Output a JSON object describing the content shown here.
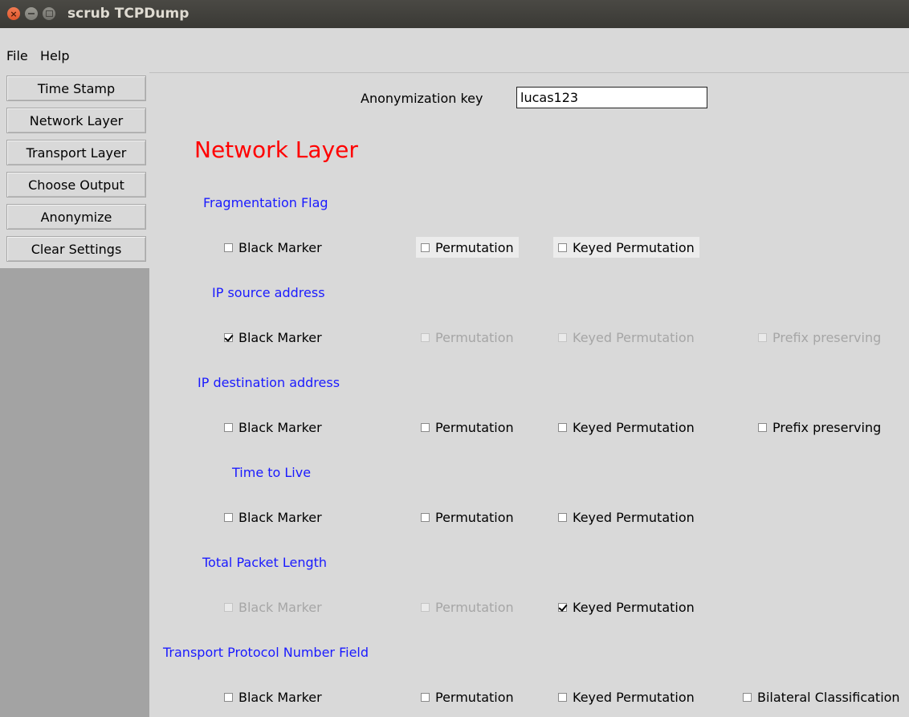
{
  "window": {
    "title": "scrub TCPDump"
  },
  "menu": [
    "File",
    "Help"
  ],
  "sidebar": {
    "buttons": [
      "Time Stamp",
      "Network Layer",
      "Transport Layer",
      "Choose Output",
      "Anonymize",
      "Clear Settings"
    ]
  },
  "key": {
    "label": "Anonymization key",
    "value": "lucas123"
  },
  "heading": "Network Layer",
  "sections": [
    {
      "title": "Fragmentation Flag",
      "options": [
        {
          "label": "Black Marker",
          "checked": false,
          "disabled": false
        },
        {
          "label": "Permutation",
          "checked": false,
          "disabled": false
        },
        {
          "label": "Keyed Permutation",
          "checked": false,
          "disabled": false
        }
      ]
    },
    {
      "title": "IP source address",
      "options": [
        {
          "label": "Black Marker",
          "checked": true,
          "disabled": false
        },
        {
          "label": "Permutation",
          "checked": false,
          "disabled": true
        },
        {
          "label": "Keyed Permutation",
          "checked": false,
          "disabled": true
        },
        {
          "label": "Prefix preserving",
          "checked": false,
          "disabled": true
        }
      ]
    },
    {
      "title": "IP destination address",
      "options": [
        {
          "label": "Black Marker",
          "checked": false,
          "disabled": false
        },
        {
          "label": "Permutation",
          "checked": false,
          "disabled": false
        },
        {
          "label": "Keyed Permutation",
          "checked": false,
          "disabled": false
        },
        {
          "label": "Prefix preserving",
          "checked": false,
          "disabled": false
        }
      ]
    },
    {
      "title": "Time to Live",
      "options": [
        {
          "label": "Black Marker",
          "checked": false,
          "disabled": false
        },
        {
          "label": "Permutation",
          "checked": false,
          "disabled": false
        },
        {
          "label": "Keyed Permutation",
          "checked": false,
          "disabled": false
        }
      ]
    },
    {
      "title": "Total Packet Length",
      "options": [
        {
          "label": "Black Marker",
          "checked": false,
          "disabled": true
        },
        {
          "label": "Permutation",
          "checked": false,
          "disabled": true
        },
        {
          "label": "Keyed Permutation",
          "checked": true,
          "disabled": false
        }
      ]
    },
    {
      "title": "Transport Protocol Number Field",
      "options": [
        {
          "label": "Black Marker",
          "checked": false,
          "disabled": false
        },
        {
          "label": "Permutation",
          "checked": false,
          "disabled": false
        },
        {
          "label": "Keyed Permutation",
          "checked": false,
          "disabled": false
        },
        {
          "label": "Bilateral Classification",
          "checked": false,
          "disabled": false
        }
      ]
    }
  ]
}
